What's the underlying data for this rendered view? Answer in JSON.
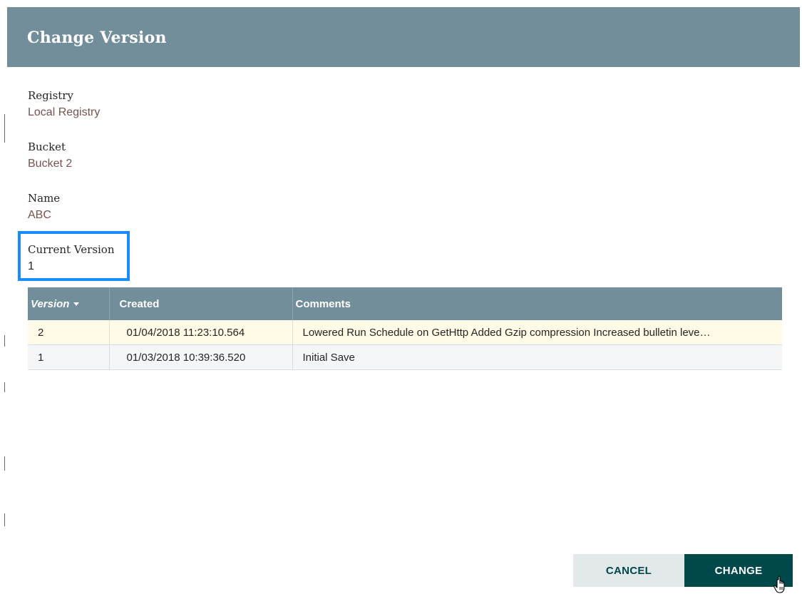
{
  "dialog": {
    "title": "Change Version"
  },
  "fields": {
    "registry": {
      "label": "Registry",
      "value": "Local Registry"
    },
    "bucket": {
      "label": "Bucket",
      "value": "Bucket 2"
    },
    "name": {
      "label": "Name",
      "value": "ABC"
    },
    "current_version": {
      "label": "Current Version",
      "value": "1"
    }
  },
  "table": {
    "columns": [
      "Version",
      "Created",
      "Comments"
    ],
    "sorted_column": "Version",
    "rows": [
      {
        "version": "2",
        "created": "01/04/2018 11:23:10.564",
        "comments": "Lowered Run Schedule on GetHttp Added Gzip compression Increased bulletin leve…",
        "selected": true
      },
      {
        "version": "1",
        "created": "01/03/2018 10:39:36.520",
        "comments": "Initial Save",
        "selected": false
      }
    ]
  },
  "buttons": {
    "cancel": "CANCEL",
    "change": "CHANGE"
  },
  "colors": {
    "header": "#728e9b",
    "value_text": "#775351",
    "highlight": "#1a8cff",
    "primary_button": "#004849",
    "secondary_button": "#e3e8eb",
    "selected_row": "#fffbe6"
  },
  "icons": {
    "sort": "caret-down-icon",
    "cursor": "hand-pointer-icon"
  }
}
